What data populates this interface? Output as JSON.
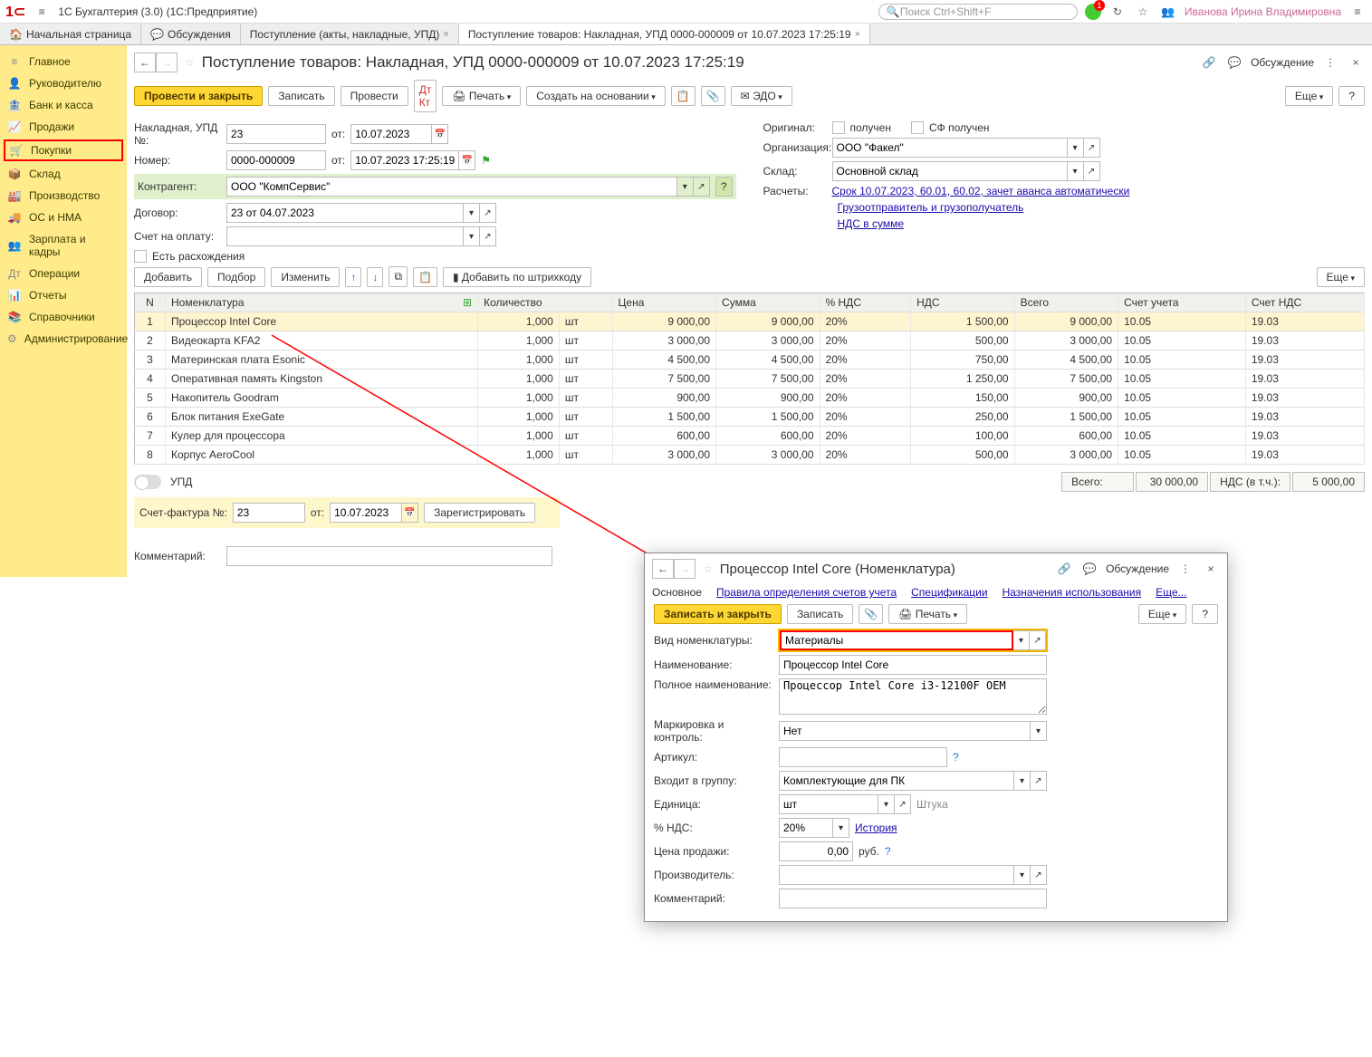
{
  "app": {
    "title": "1С Бухгалтерия (3.0)  (1С:Предприятие)",
    "search_ph": "Поиск Ctrl+Shift+F",
    "user": "Иванова Ирина Владимировна"
  },
  "tabs": {
    "t0": {
      "label": "Начальная страница"
    },
    "t1": {
      "label": "Обсуждения"
    },
    "t2": {
      "label": "Поступление (акты, накладные, УПД)"
    },
    "t3": {
      "label": "Поступление товаров: Накладная, УПД 0000-000009 от 10.07.2023 17:25:19"
    }
  },
  "sidebar": {
    "i0": "Главное",
    "i1": "Руководителю",
    "i2": "Банк и касса",
    "i3": "Продажи",
    "i4": "Покупки",
    "i5": "Склад",
    "i6": "Производство",
    "i7": "ОС и НМА",
    "i8": "Зарплата и кадры",
    "i9": "Операции",
    "i10": "Отчеты",
    "i11": "Справочники",
    "i12": "Администрирование"
  },
  "doc": {
    "title": "Поступление товаров: Накладная, УПД 0000-000009 от 10.07.2023 17:25:19",
    "discuss": "Обсуждение",
    "btn_post_close": "Провести и закрыть",
    "btn_save": "Записать",
    "btn_post": "Провести",
    "btn_print": "Печать",
    "btn_base": "Создать на основании",
    "btn_edo": "ЭДО",
    "btn_more": "Еще",
    "btn_help": "?",
    "lbl_nakl": "Накладная, УПД №:",
    "nakl_no": "23",
    "lbl_ot": "от:",
    "nakl_date": "10.07.2023",
    "lbl_num": "Номер:",
    "num": "0000-000009",
    "num_dt": "10.07.2023 17:25:19",
    "lbl_kontr": "Контрагент:",
    "kontr": "ООО \"КомпСервис\"",
    "lbl_dog": "Договор:",
    "dog": "23 от 04.07.2023",
    "lbl_schet": "Счет на оплату:",
    "lbl_rash": "Есть расхождения",
    "lbl_orig": "Оригинал:",
    "chk_got": "получен",
    "chk_sf": "СФ получен",
    "lbl_org": "Организация:",
    "org": "ООО \"Факел\"",
    "lbl_sklad": "Склад:",
    "sklad": "Основной склад",
    "lbl_rasch": "Расчеты:",
    "rasch_link": "Срок 10.07.2023, 60.01, 60.02, зачет аванса автоматически",
    "link_gruz": "Грузоотправитель и грузополучатель",
    "link_nds": "НДС в сумме",
    "btn_add": "Добавить",
    "btn_pick": "Подбор",
    "btn_edit": "Изменить",
    "btn_bar": "Добавить по штрихкоду",
    "th_n": "N",
    "th_nom": "Номенклатура",
    "th_kol": "Количество",
    "th_cena": "Цена",
    "th_sum": "Сумма",
    "th_pnds": "% НДС",
    "th_nds": "НДС",
    "th_vsego": "Всего",
    "th_su": "Счет учета",
    "th_snds": "Счет НДС",
    "upd": "УПД",
    "tot_lbl": "Всего:",
    "tot_val": "30 000,00",
    "tot_nds_lbl": "НДС (в т.ч.):",
    "tot_nds_val": "5 000,00",
    "sf_lbl": "Счет-фактура №:",
    "sf_no": "23",
    "sf_date": "10.07.2023",
    "btn_reg": "Зарегистрировать",
    "lbl_comment": "Комментарий:"
  },
  "rows": {
    "r1": {
      "n": "1",
      "nom": "Процессор Intel Core",
      "kol": "1,000",
      "ed": "шт",
      "cena": "9 000,00",
      "sum": "9 000,00",
      "pnds": "20%",
      "nds": "1 500,00",
      "vsego": "9 000,00",
      "su": "10.05",
      "snds": "19.03"
    },
    "r2": {
      "n": "2",
      "nom": "Видеокарта KFA2",
      "kol": "1,000",
      "ed": "шт",
      "cena": "3 000,00",
      "sum": "3 000,00",
      "pnds": "20%",
      "nds": "500,00",
      "vsego": "3 000,00",
      "su": "10.05",
      "snds": "19.03"
    },
    "r3": {
      "n": "3",
      "nom": "Материнская плата Esonic",
      "kol": "1,000",
      "ed": "шт",
      "cena": "4 500,00",
      "sum": "4 500,00",
      "pnds": "20%",
      "nds": "750,00",
      "vsego": "4 500,00",
      "su": "10.05",
      "snds": "19.03"
    },
    "r4": {
      "n": "4",
      "nom": "Оперативная память Kingston",
      "kol": "1,000",
      "ed": "шт",
      "cena": "7 500,00",
      "sum": "7 500,00",
      "pnds": "20%",
      "nds": "1 250,00",
      "vsego": "7 500,00",
      "su": "10.05",
      "snds": "19.03"
    },
    "r5": {
      "n": "5",
      "nom": "Накопитель Goodram",
      "kol": "1,000",
      "ed": "шт",
      "cena": "900,00",
      "sum": "900,00",
      "pnds": "20%",
      "nds": "150,00",
      "vsego": "900,00",
      "su": "10.05",
      "snds": "19.03"
    },
    "r6": {
      "n": "6",
      "nom": "Блок питания ExeGate",
      "kol": "1,000",
      "ed": "шт",
      "cena": "1 500,00",
      "sum": "1 500,00",
      "pnds": "20%",
      "nds": "250,00",
      "vsego": "1 500,00",
      "su": "10.05",
      "snds": "19.03"
    },
    "r7": {
      "n": "7",
      "nom": "Кулер для процессора",
      "kol": "1,000",
      "ed": "шт",
      "cena": "600,00",
      "sum": "600,00",
      "pnds": "20%",
      "nds": "100,00",
      "vsego": "600,00",
      "su": "10.05",
      "snds": "19.03"
    },
    "r8": {
      "n": "8",
      "nom": "Корпус AeroCool",
      "kol": "1,000",
      "ed": "шт",
      "cena": "3 000,00",
      "sum": "3 000,00",
      "pnds": "20%",
      "nds": "500,00",
      "vsego": "3 000,00",
      "su": "10.05",
      "snds": "19.03"
    }
  },
  "sub": {
    "title": "Процессор Intel Core (Номенклатура)",
    "discuss": "Обсуждение",
    "tab_main": "Основное",
    "tab_rules": "Правила определения счетов учета",
    "tab_spec": "Спецификации",
    "tab_nazn": "Назначения использования",
    "tab_more": "Еще...",
    "btn_save_close": "Записать и закрыть",
    "btn_save": "Записать",
    "btn_print": "Печать",
    "btn_more": "Еще",
    "btn_help": "?",
    "lbl_vid": "Вид номенклатуры:",
    "vid": "Материалы",
    "lbl_name": "Наименование:",
    "name": "Процессор Intel Core",
    "lbl_full": "Полное наименование:",
    "full": "Процессор Intel Core i3-12100F OEM",
    "lbl_mark": "Маркировка и контроль:",
    "mark": "Нет",
    "lbl_art": "Артикул:",
    "art": "",
    "lbl_grp": "Входит в группу:",
    "grp": "Комплектующие для ПК",
    "lbl_ed": "Единица:",
    "ed": "шт",
    "ed_full": "Штука",
    "lbl_nds": "% НДС:",
    "nds": "20%",
    "hist": "История",
    "lbl_price": "Цена продажи:",
    "price": "0,00",
    "rub": "руб.",
    "lbl_prod": "Производитель:",
    "lbl_comm": "Комментарий:"
  }
}
